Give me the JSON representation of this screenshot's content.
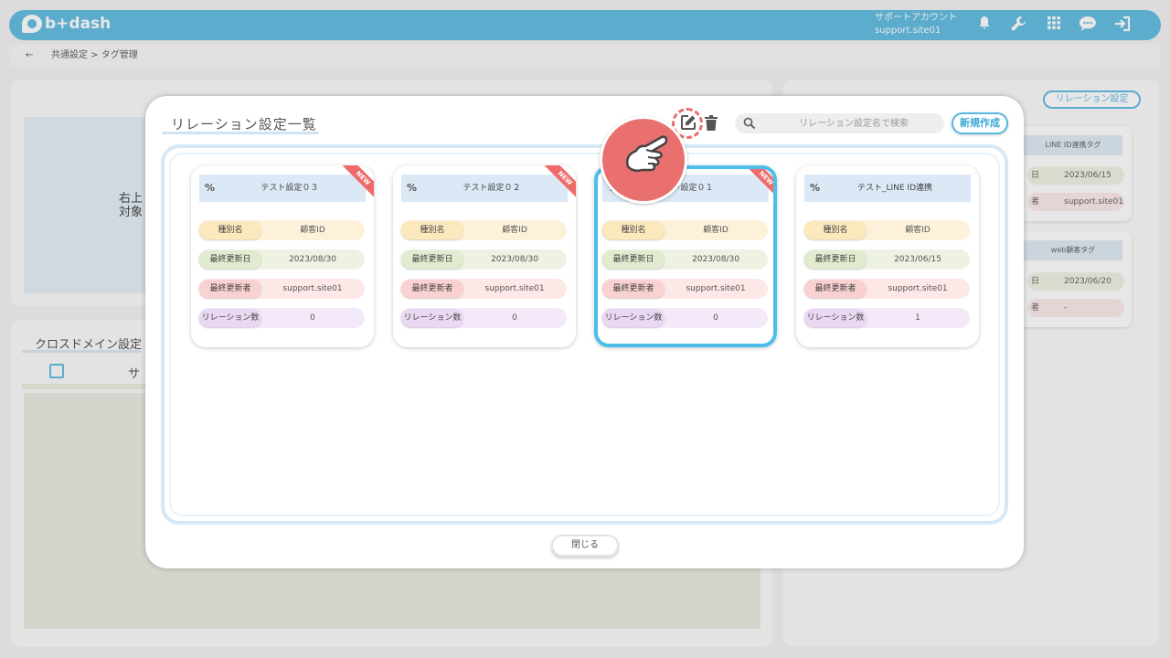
{
  "header": {
    "logo": "b+dash",
    "account_label": "サポートアカウント",
    "account_id": "support.site01",
    "icons": [
      "bell-icon",
      "wrench-icon",
      "grid-icon",
      "chat-icon",
      "logout-icon"
    ],
    "accent_color": "#56b8e0"
  },
  "breadcrumb": {
    "back": "←",
    "path": "共通設定 > タグ管理"
  },
  "background": {
    "left_text_line1": "右上",
    "left_text_line2": "対象",
    "cross_domain_title": "クロスドメイン設定",
    "cross_domain_col": "サ",
    "relation_button": "リレーション設定",
    "side_cards": [
      {
        "title": "LINE ID連携タグ",
        "rows": [
          {
            "k": "日",
            "v": "2023/06/15"
          },
          {
            "k": "者",
            "v": "support.site01"
          }
        ]
      },
      {
        "title": "web顧客タグ",
        "rows": [
          {
            "k": "日",
            "v": "2023/06/20"
          },
          {
            "k": "者",
            "v": "-"
          }
        ]
      }
    ]
  },
  "modal": {
    "title": "リレーション設定一覧",
    "search_placeholder": "リレーション設定名で検索",
    "new_button": "新規作成",
    "close_button": "閉じる",
    "labels": {
      "type": "種別名",
      "updated_date": "最終更新日",
      "updated_by": "最終更新者",
      "relation_count": "リレーション数"
    },
    "cards": [
      {
        "name": "テスト設定０３",
        "is_new": true,
        "selected": false,
        "type": "顧客ID",
        "updated_date": "2023/08/30",
        "updated_by": "support.site01",
        "relation_count": "0"
      },
      {
        "name": "テスト設定０２",
        "is_new": true,
        "selected": false,
        "type": "顧客ID",
        "updated_date": "2023/08/30",
        "updated_by": "support.site01",
        "relation_count": "0"
      },
      {
        "name": "ト設定０１",
        "is_new": true,
        "selected": true,
        "type": "顧客ID",
        "updated_date": "2023/08/30",
        "updated_by": "support.site01",
        "relation_count": "0"
      },
      {
        "name": "テスト_LINE ID連携",
        "is_new": false,
        "selected": false,
        "type": "顧客ID",
        "updated_date": "2023/06/15",
        "updated_by": "support.site01",
        "relation_count": "1"
      }
    ],
    "new_badge": "NEW"
  }
}
